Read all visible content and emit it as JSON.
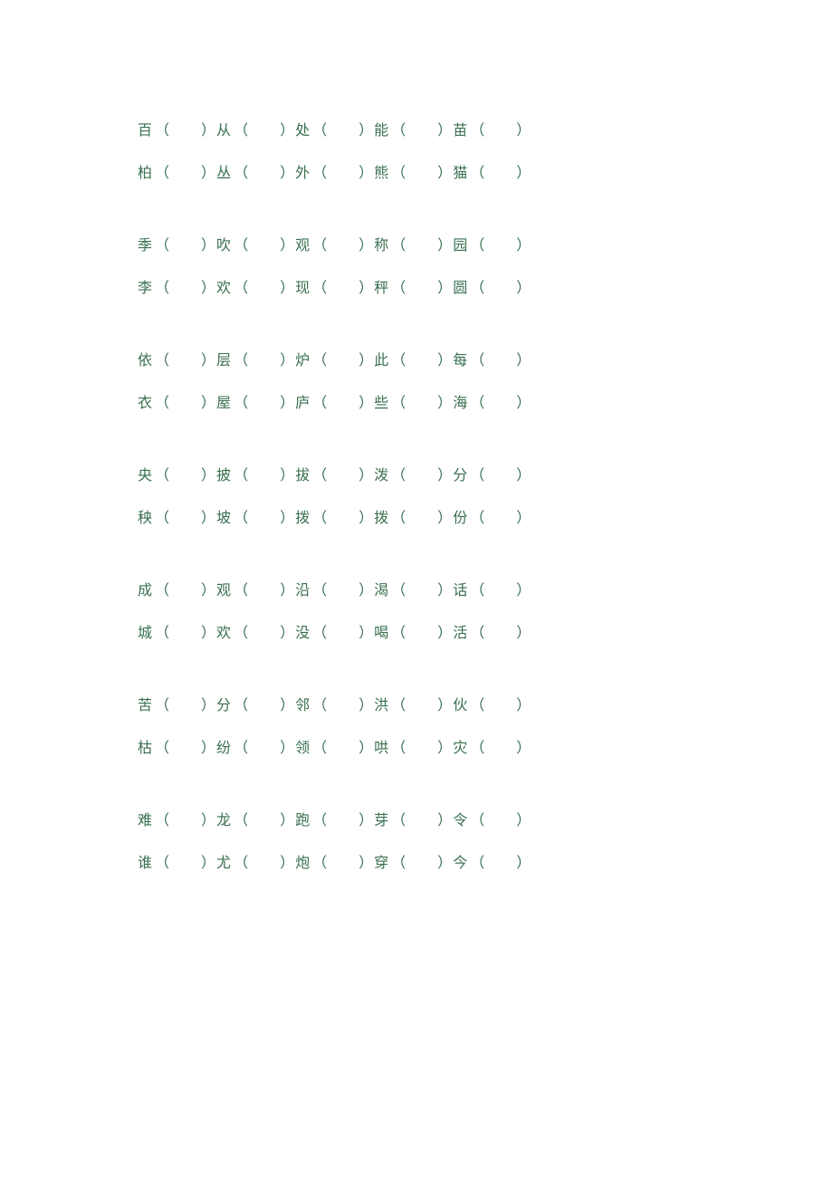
{
  "groups": [
    {
      "rows": [
        [
          "百",
          "从",
          "处",
          "能",
          "苗"
        ],
        [
          "柏",
          "丛",
          "外",
          "熊",
          "猫"
        ]
      ]
    },
    {
      "rows": [
        [
          "季",
          "吹",
          "观",
          "称",
          "园"
        ],
        [
          "李",
          "欢",
          "现",
          "秤",
          "圆"
        ]
      ]
    },
    {
      "rows": [
        [
          "依",
          "层",
          "炉",
          "此",
          "每"
        ],
        [
          "衣",
          "屋",
          "庐",
          "些",
          "海"
        ]
      ]
    },
    {
      "rows": [
        [
          "央",
          "披",
          "拔",
          "泼",
          "分"
        ],
        [
          "秧",
          "坡",
          "拨",
          "拨",
          "份"
        ]
      ]
    },
    {
      "rows": [
        [
          "成",
          "观",
          "沿",
          "渴",
          "话"
        ],
        [
          "城",
          "欢",
          "没",
          "喝",
          "活"
        ]
      ]
    },
    {
      "rows": [
        [
          "苦",
          "分",
          "邻",
          "洪",
          "伙"
        ],
        [
          "枯",
          "纷",
          "领",
          "哄",
          "灾"
        ]
      ]
    },
    {
      "rows": [
        [
          "难",
          "龙",
          "跑",
          "芽",
          "令"
        ],
        [
          "谁",
          "尤",
          "炮",
          "穿",
          "今"
        ]
      ],
      "tight": true
    }
  ],
  "paren_open": "（",
  "paren_close": "）"
}
